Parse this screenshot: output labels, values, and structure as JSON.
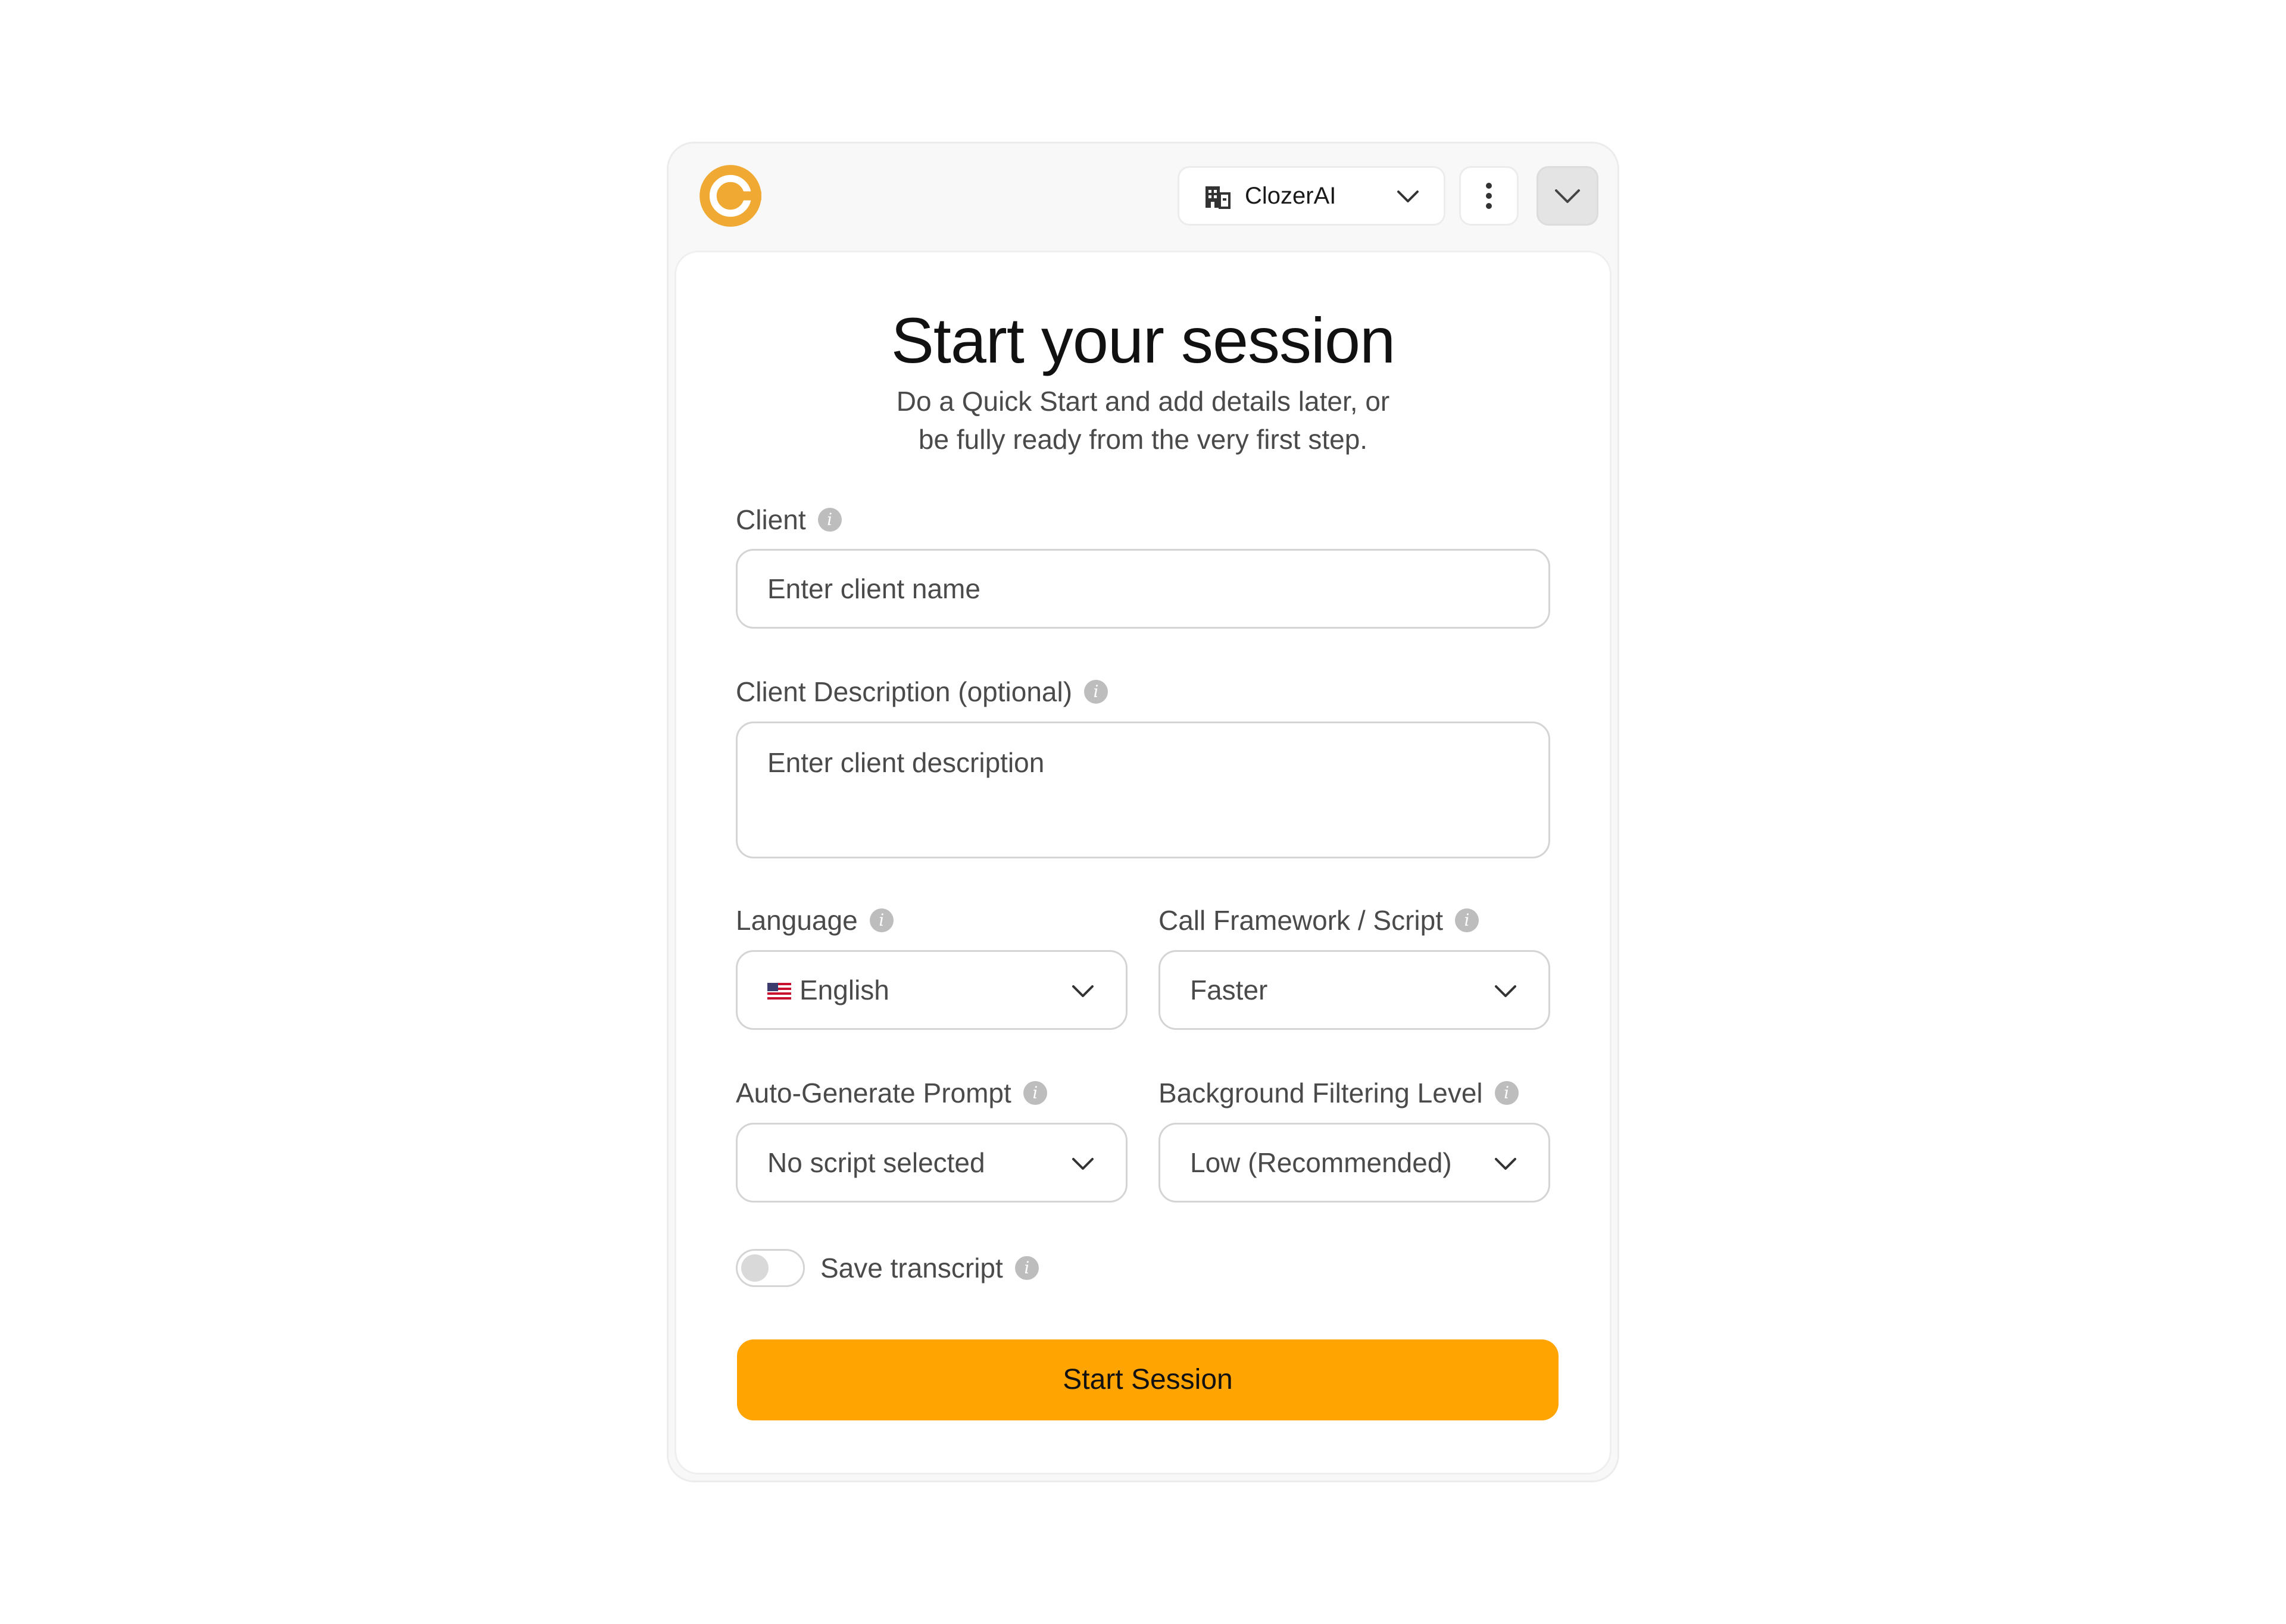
{
  "header": {
    "org_name": "ClozerAI",
    "brand_color": "#F0A933"
  },
  "main": {
    "title": "Start your session",
    "subtitle_line1": "Do a Quick Start and add details later, or",
    "subtitle_line2": "be fully ready from the very first step."
  },
  "form": {
    "client": {
      "label": "Client",
      "placeholder": "Enter client name"
    },
    "client_description": {
      "label": "Client Description (optional)",
      "placeholder": "Enter client description"
    },
    "language": {
      "label": "Language",
      "value": "English",
      "flag": "🇺🇸"
    },
    "call_framework": {
      "label": "Call Framework / Script",
      "value": "Faster"
    },
    "auto_generate_prompt": {
      "label": "Auto-Generate Prompt",
      "value": "No script selected"
    },
    "background_filtering": {
      "label": "Background Filtering Level",
      "value": "Low (Recommended)"
    },
    "save_transcript": {
      "label": "Save transcript",
      "enabled": false
    },
    "submit_label": "Start Session"
  },
  "icons": {
    "info": "i"
  },
  "colors": {
    "accent": "#FFA400",
    "info_icon": "#BDBDBD",
    "border": "#D4D4D4"
  }
}
